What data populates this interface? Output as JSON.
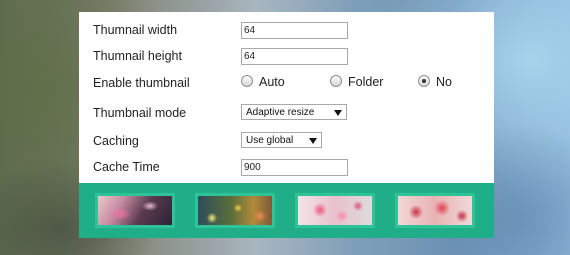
{
  "form": {
    "thumb_width": {
      "label": "Thumnail width",
      "value": "64"
    },
    "thumb_height": {
      "label": "Thumnail height",
      "value": "64"
    },
    "enable_thumb": {
      "label": "Enable thumbnail",
      "options": [
        {
          "label": "Auto",
          "checked": false
        },
        {
          "label": "Folder",
          "checked": false
        },
        {
          "label": "No",
          "checked": true
        }
      ]
    },
    "thumb_mode": {
      "label": "Thumbnail mode",
      "selected": "Adaptive resize"
    },
    "caching": {
      "label": "Caching",
      "selected": "Use global"
    },
    "cache_time": {
      "label": "Cache Time",
      "value": "900"
    }
  },
  "colors": {
    "strip_bg": "#1fae87",
    "thumb_border": "#2fc398",
    "panel_bg": "#ffffff"
  },
  "thumbnails": [
    {
      "name": "pink-branch-photo"
    },
    {
      "name": "bokeh-flowers-photo"
    },
    {
      "name": "pink-roses-photo"
    },
    {
      "name": "red-blossoms-photo"
    }
  ]
}
